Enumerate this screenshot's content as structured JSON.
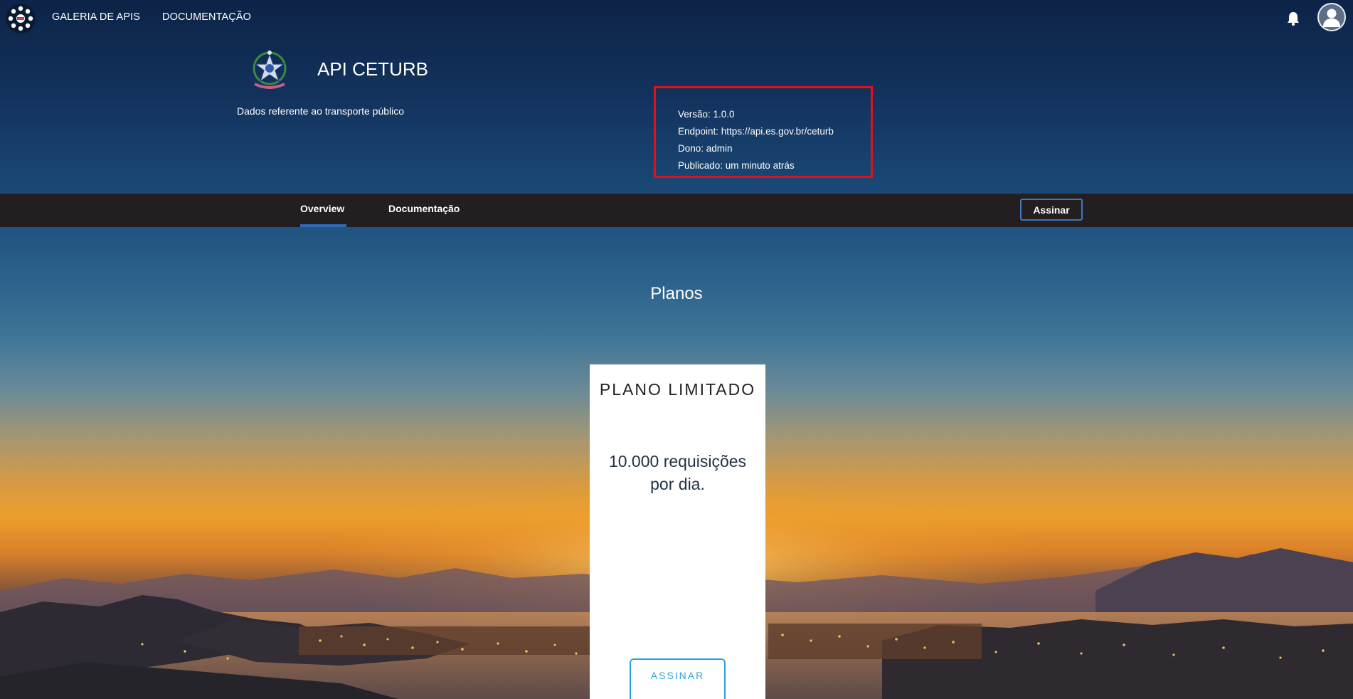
{
  "nav": {
    "links": [
      "GALERIA DE APIS",
      "DOCUMENTAÇÃO"
    ]
  },
  "api": {
    "title": "API CETURB",
    "description": "Dados referente ao transporte público",
    "info": {
      "version": "Versão: 1.0.0",
      "endpoint": "Endpoint: https://api.es.gov.br/ceturb",
      "owner": "Dono: admin",
      "published": "Publicado: um minuto atrás"
    }
  },
  "tabs": {
    "overview": "Overview",
    "documentation": "Documentação",
    "subscribe": "Assinar"
  },
  "plans": {
    "heading": "Planos",
    "items": [
      {
        "title": "PLANO LIMITADO",
        "description": "10.000 requisições por dia.",
        "button": "ASSINAR"
      }
    ]
  },
  "colors": {
    "tabbar_bg": "#231f20",
    "tab_active_underline": "#2f68b3",
    "highlight_box": "#e0111b",
    "plan_button": "#2aa5d6"
  },
  "icons": [
    "portal-logo-icon",
    "bell-icon",
    "user-avatar-icon",
    "state-coat-of-arms-icon"
  ]
}
